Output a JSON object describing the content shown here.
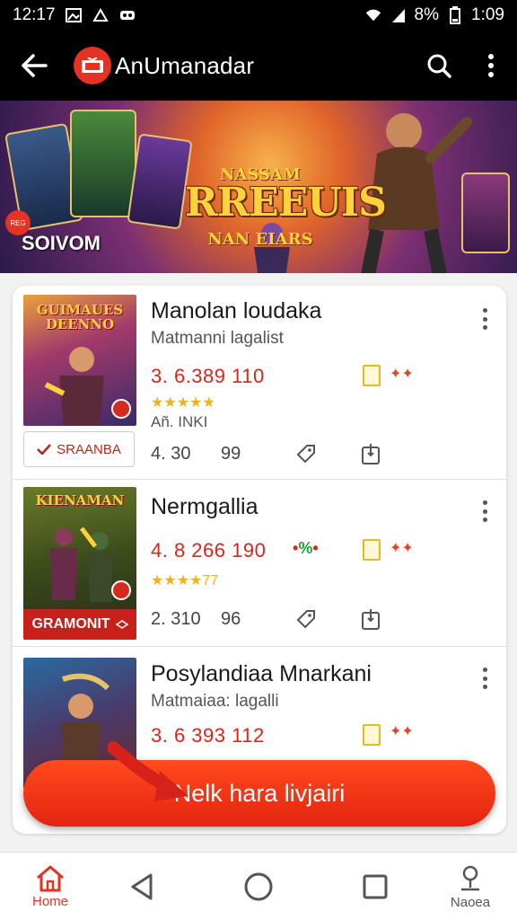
{
  "status_bar": {
    "time": "12:17",
    "battery": "8%",
    "clock_right": "1:09"
  },
  "app_bar": {
    "title": "AnUmanadar"
  },
  "banner": {
    "top_text": "NASSAM",
    "title": "RREEUIS",
    "subtitle": "NAN EIARS",
    "label": "SOIVOM",
    "badge": "REG"
  },
  "items": [
    {
      "thumb_title": "GUIMAUES DEENNO",
      "title": "Manolan loudaka",
      "subtitle": "Matmanni lagalist",
      "price": "3. 6.389 110",
      "stars": "★★★★★",
      "meta": "Añ. INKI",
      "button_label": "SRAANBA",
      "stat1": "4. 30",
      "stat2": "99"
    },
    {
      "thumb_title": "KIENAMAN",
      "thumb_footer": "GRAMONIT",
      "title": "Nermgallia",
      "price": "4. 8 266 190",
      "stars": "★★★★",
      "stars_text": "77",
      "stat1": "2. 310",
      "stat2": "96"
    },
    {
      "title": "Posylandiaa Mnarkani",
      "subtitle": "Matmaiaa: lagalli",
      "price": "3. 6 393 112"
    }
  ],
  "cta": {
    "label": "Nelk hara livjairi"
  },
  "bottom_nav": {
    "home_label": "Home",
    "right_label": "Naoea"
  },
  "colors": {
    "accent": "#e53222",
    "cta": "#f2341a",
    "star": "#f2b01e",
    "price": "#d8261c"
  }
}
